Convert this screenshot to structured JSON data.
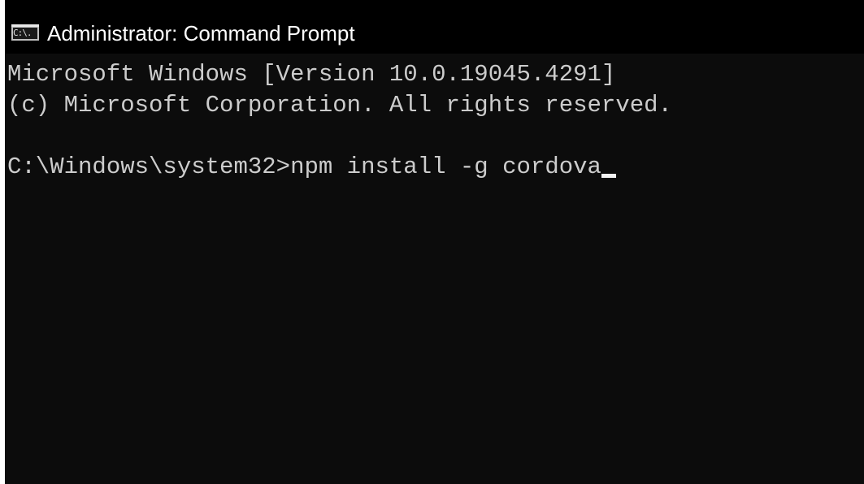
{
  "window": {
    "title": "Administrator: Command Prompt",
    "icon_text": "C:\\.",
    "icon": "cmd-console-icon"
  },
  "console": {
    "lines": [
      "Microsoft Windows [Version 10.0.19045.4291]",
      "(c) Microsoft Corporation. All rights reserved.",
      ""
    ],
    "prompt": "C:\\Windows\\system32>",
    "command": "npm install -g cordova"
  },
  "colors": {
    "titlebar_bg": "#000000",
    "console_bg": "#0c0c0c",
    "text": "#cccccc",
    "cursor": "#f2f2f2"
  }
}
